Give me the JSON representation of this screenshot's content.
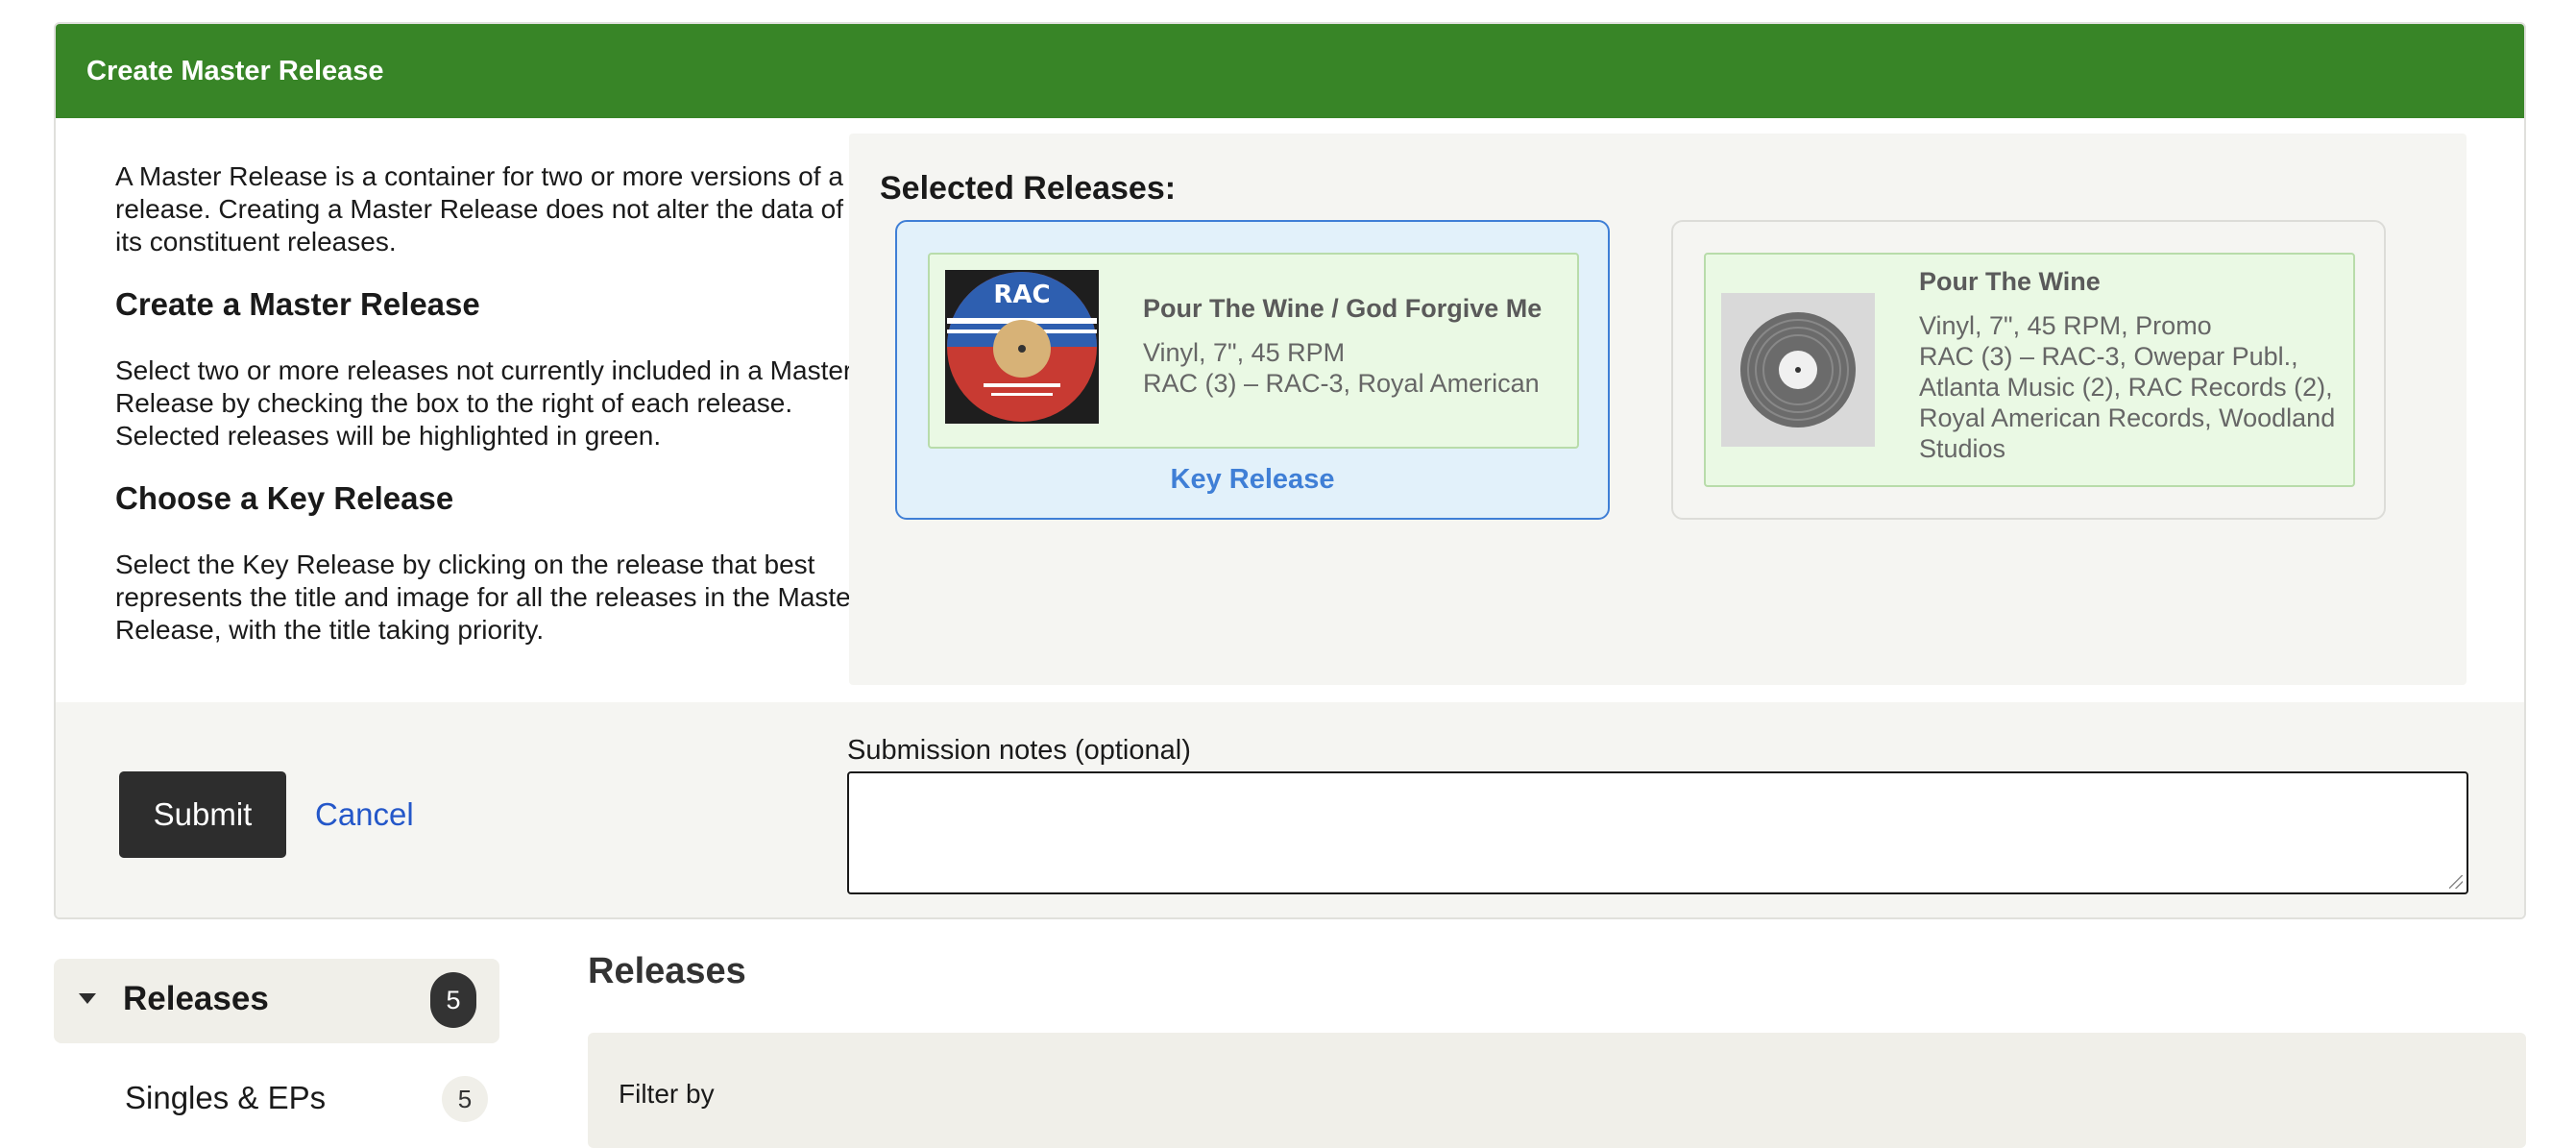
{
  "header": {
    "title": "Create Master Release"
  },
  "intro": {
    "paragraph1": "A Master Release is a container for two or more versions of a release. Creating a Master Release does not alter the data of its constituent releases.",
    "heading1": "Create a Master Release",
    "paragraph2": "Select two or more releases not currently included in a Master Release by checking the box to the right of each release. Selected releases will be highlighted in green.",
    "heading2": "Choose a Key Release",
    "paragraph3": "Select the Key Release by clicking on the release that best represents the title and image for all the releases in the Master Release, with the title taking priority."
  },
  "selected": {
    "title": "Selected Releases:",
    "releases": [
      {
        "title": "Pour The Wine / God Forgive Me",
        "format": "Vinyl, 7\", 45 RPM",
        "label": "RAC (3) – RAC-3, Royal American",
        "key_label": "Key Release",
        "image": "record-label-image"
      },
      {
        "title": "Pour The Wine",
        "format": "Vinyl, 7\", 45 RPM, Promo",
        "label": "RAC (3) – RAC-3, Owepar Publ., Atlanta Music (2), RAC Records (2), Royal American Records, Woodland Studios",
        "image": "vinyl-placeholder-icon"
      }
    ]
  },
  "actions": {
    "submit_label": "Submit",
    "cancel_label": "Cancel",
    "notes_label": "Submission notes (optional)",
    "notes_value": ""
  },
  "sidebar": {
    "active_label": "Releases",
    "active_count": "5",
    "items": [
      {
        "label": "Singles & EPs",
        "count": "5"
      }
    ]
  },
  "main": {
    "title": "Releases",
    "filter_label": "Filter by"
  },
  "colors": {
    "header_green": "#388527",
    "key_blue": "#3f7fd6",
    "selected_green_bg": "#eaf9e4",
    "link_blue": "#2457c9"
  }
}
